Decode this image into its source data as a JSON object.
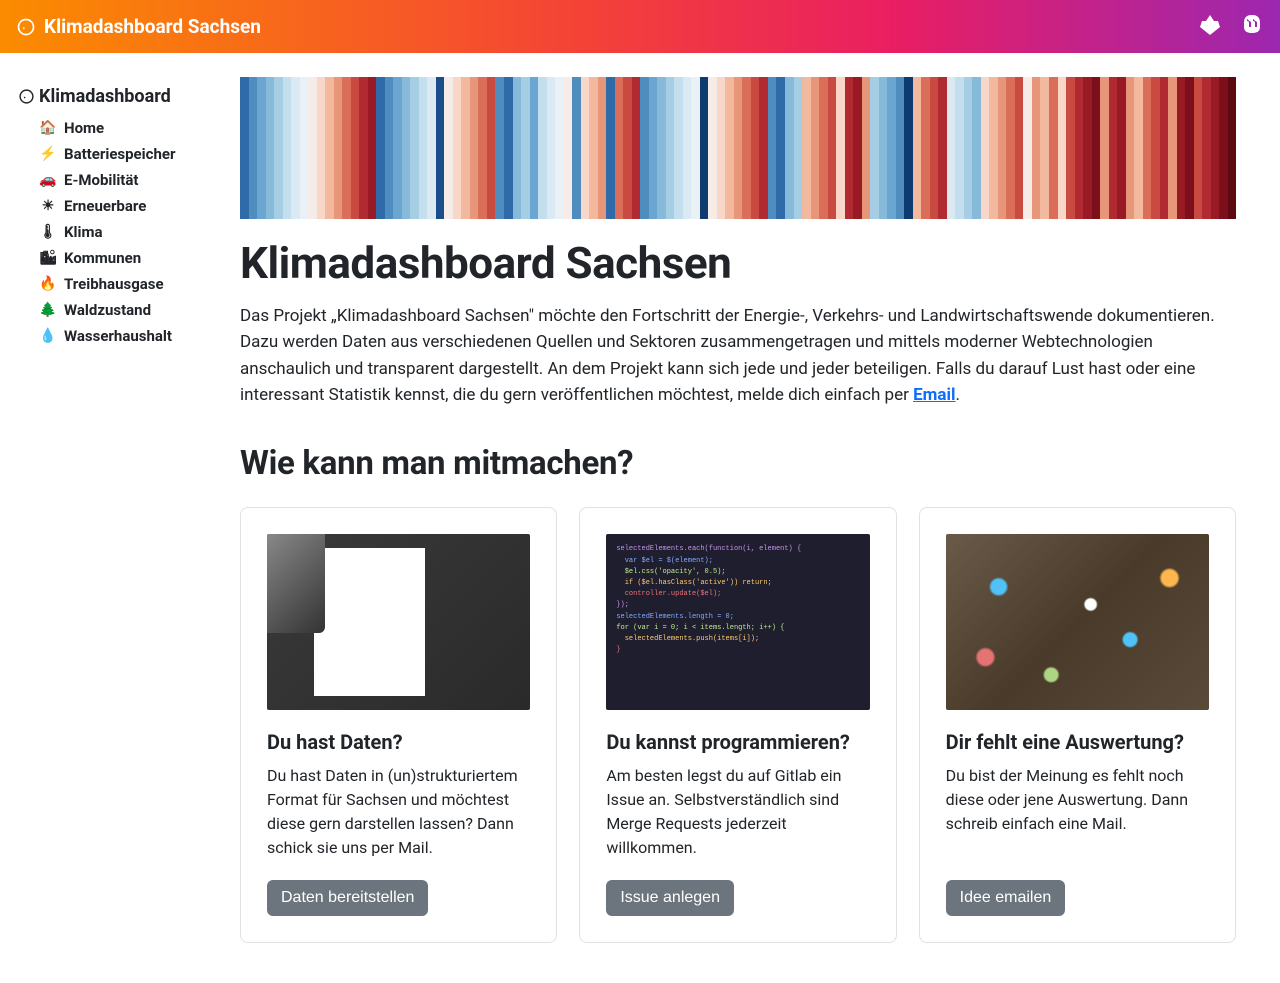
{
  "header": {
    "title": "Klimadashboard Sachsen",
    "icons": {
      "gitlab": "gitlab-icon",
      "mastodon": "mastodon-icon"
    }
  },
  "sidebar": {
    "title": "Klimadashboard",
    "items": [
      {
        "icon": "home-icon",
        "glyph": "🏠",
        "label": "Home"
      },
      {
        "icon": "battery-icon",
        "glyph": "⚡",
        "label": "Batteriespeicher"
      },
      {
        "icon": "car-icon",
        "glyph": "🚗",
        "label": "E-Mobilität"
      },
      {
        "icon": "solar-icon",
        "glyph": "☀",
        "label": "Erneuerbare"
      },
      {
        "icon": "thermometer-icon",
        "glyph": "🌡",
        "label": "Klima"
      },
      {
        "icon": "city-icon",
        "glyph": "🏙",
        "label": "Kommunen"
      },
      {
        "icon": "fire-icon",
        "glyph": "🔥",
        "label": "Treibhausgase"
      },
      {
        "icon": "tree-icon",
        "glyph": "🌲",
        "label": "Waldzustand"
      },
      {
        "icon": "water-icon",
        "glyph": "💧",
        "label": "Wasserhaushalt"
      }
    ]
  },
  "main": {
    "title": "Klimadashboard Sachsen",
    "intro": "Das Projekt „Klimadashboard Sachsen\" möchte den Fortschritt der Energie-, Verkehrs- und Landwirtschaftswende dokumentieren. Dazu werden Daten aus verschiedenen Quellen und Sektoren zusammengetragen und mittels moderner Webtechnologien anschaulich und transparent dargestellt. An dem Projekt kann sich jede und jeder beteiligen. Falls du darauf Lust hast oder eine interessant Statistik kennst, die du gern veröffentlichen möchtest, melde dich einfach per ",
    "intro_link": "Email",
    "intro_suffix": ".",
    "subtitle": "Wie kann man mitmachen?",
    "cards": [
      {
        "title": "Du hast Daten?",
        "text": "Du hast Daten in (un)strukturiertem Format für Sachsen und möchtest diese gern darstellen lassen? Dann schick sie uns per Mail.",
        "button": "Daten bereitstellen"
      },
      {
        "title": "Du kannst programmieren?",
        "text": "Am besten legst du auf Gitlab ein Issue an. Selbstverständlich sind Merge Requests jederzeit willkommen.",
        "button": "Issue anlegen"
      },
      {
        "title": "Dir fehlt eine Auswertung?",
        "text": "Du bist der Meinung es fehlt noch diese oder jene Auswertung. Dann schreib einfach eine Mail.",
        "button": "Idee emailen"
      }
    ]
  },
  "stripes": [
    "#2f6ba8",
    "#4f8dbf",
    "#6ba5d1",
    "#87bad9",
    "#a5cde3",
    "#c3deed",
    "#dbe9f2",
    "#e9f1f7",
    "#f5ece7",
    "#f8d7c8",
    "#f3b99f",
    "#e8967a",
    "#da6e58",
    "#c94a40",
    "#b22a31",
    "#971a25",
    "#2f6ba8",
    "#4f8dbf",
    "#6ba5d1",
    "#87bad9",
    "#a5cde3",
    "#c3deed",
    "#dbe9f2",
    "#1a4d8a",
    "#f5ece7",
    "#f8d7c8",
    "#f3b99f",
    "#e8967a",
    "#da6e58",
    "#c94a40",
    "#4f8dbf",
    "#2f6ba8",
    "#87bad9",
    "#a5cde3",
    "#6ba5d1",
    "#c3deed",
    "#dbe9f2",
    "#e9f1f7",
    "#f5ece7",
    "#4f8dbf",
    "#f8d7c8",
    "#f3b99f",
    "#e8967a",
    "#2f6ba8",
    "#da6e58",
    "#c94a40",
    "#b22a31",
    "#4f8dbf",
    "#6ba5d1",
    "#87bad9",
    "#a5cde3",
    "#c3deed",
    "#dbe9f2",
    "#e9f1f7",
    "#0d3a6f",
    "#f5ece7",
    "#f8d7c8",
    "#f3b99f",
    "#e8967a",
    "#da6e58",
    "#c94a40",
    "#b22a31",
    "#4f8dbf",
    "#2f6ba8",
    "#87bad9",
    "#a5cde3",
    "#f3b99f",
    "#e8967a",
    "#da6e58",
    "#c94a40",
    "#f8d7c8",
    "#b22a31",
    "#971a25",
    "#e8967a",
    "#a5cde3",
    "#87bad9",
    "#6ba5d1",
    "#4f8dbf",
    "#0d3a6f",
    "#f3b99f",
    "#da6e58",
    "#c94a40",
    "#b22a31",
    "#dbe9f2",
    "#c3deed",
    "#a5cde3",
    "#87bad9",
    "#f8d7c8",
    "#f3b99f",
    "#e8967a",
    "#da6e58",
    "#c94a40",
    "#f5ece7",
    "#e8967a",
    "#f3b99f",
    "#da6e58",
    "#f8d7c8",
    "#c94a40",
    "#b22a31",
    "#971a25",
    "#7d0f1c",
    "#e8967a",
    "#b22a31",
    "#971a25",
    "#e8967a",
    "#f3b99f",
    "#da6e58",
    "#c94a40",
    "#b22a31",
    "#e8967a",
    "#971a25",
    "#7d0f1c",
    "#c94a40",
    "#b22a31",
    "#971a25",
    "#7d0f1c",
    "#5e0812"
  ]
}
